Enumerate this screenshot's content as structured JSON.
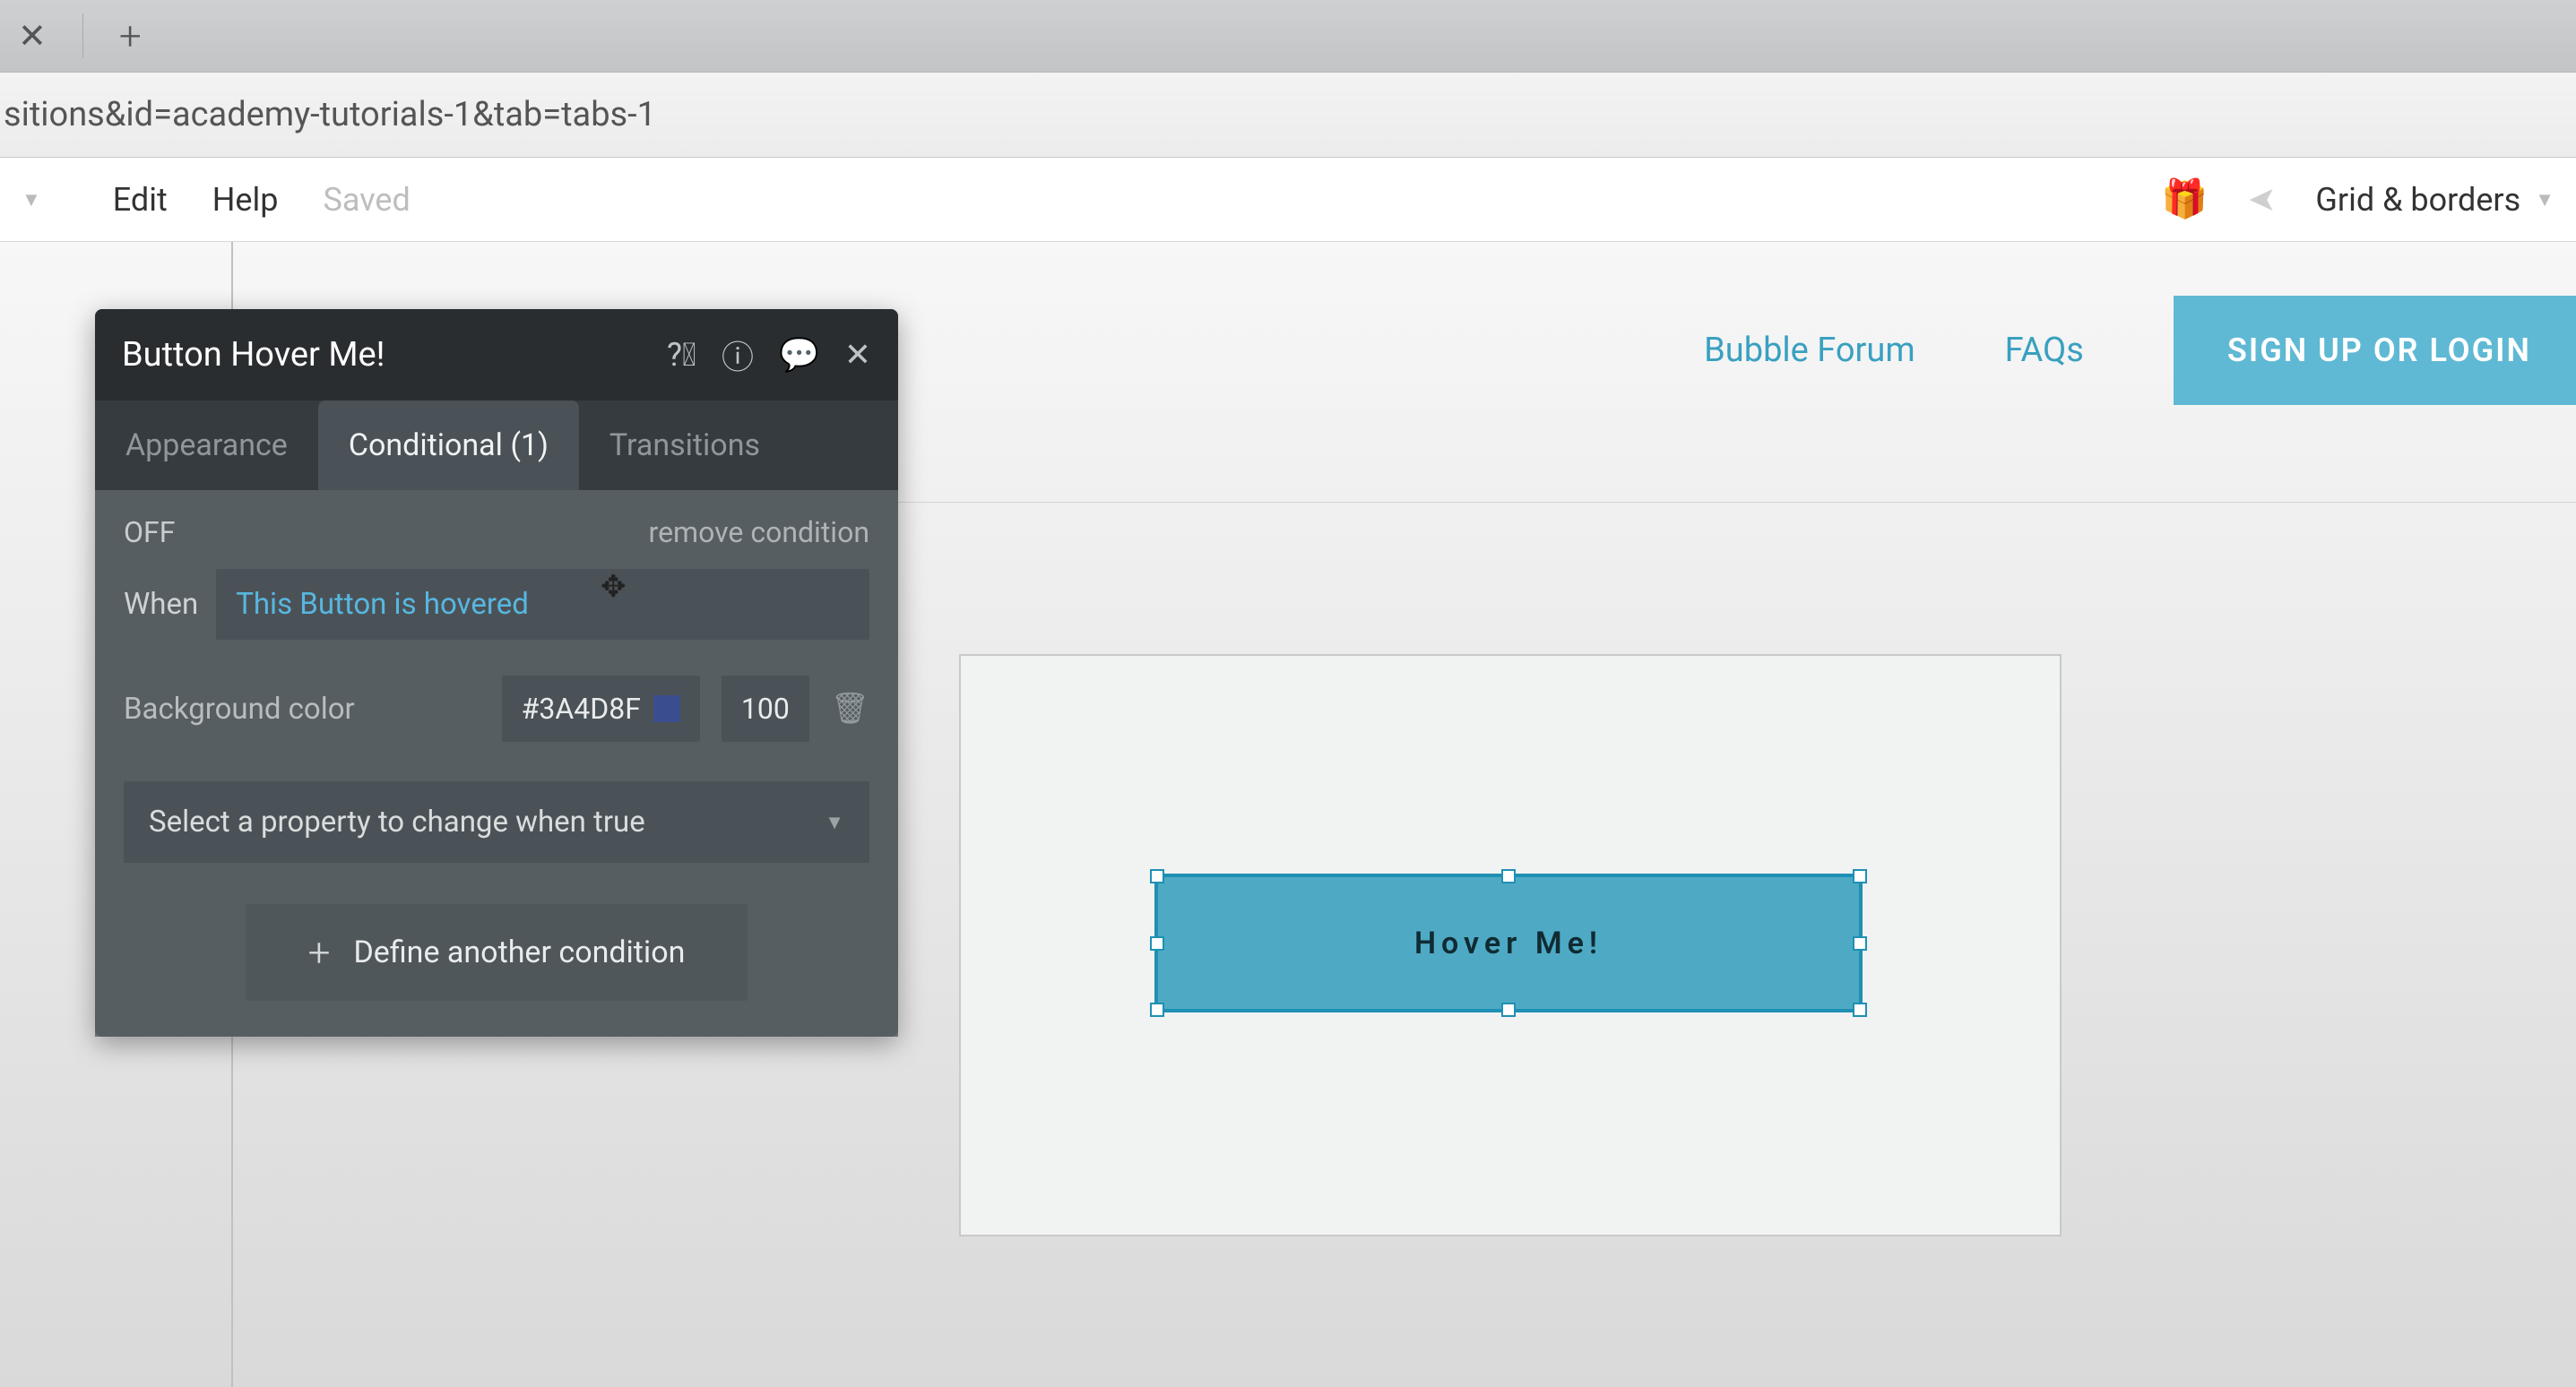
{
  "browser": {
    "url_fragment": "sitions&id=academy-tutorials-1&tab=tabs-1"
  },
  "toolbar": {
    "edit": "Edit",
    "help": "Help",
    "saved": "Saved",
    "grid_borders": "Grid & borders"
  },
  "canvas_nav": {
    "forum": "Bubble Forum",
    "faqs": "FAQs",
    "signup": "SIGN UP OR LOGIN"
  },
  "selected_button": {
    "label": "Hover Me!"
  },
  "panel": {
    "title": "Button Hover Me!",
    "tabs": {
      "appearance": "Appearance",
      "conditional": "Conditional (1)",
      "transitions": "Transitions"
    },
    "condition": {
      "state": "OFF",
      "remove": "remove condition",
      "when_label": "When",
      "expression": "This Button is hovered",
      "prop_label": "Background color",
      "hex": "#3A4D8F",
      "opacity": "100",
      "dropdown_placeholder": "Select a property to change when true",
      "define_another": "Define another condition"
    }
  }
}
